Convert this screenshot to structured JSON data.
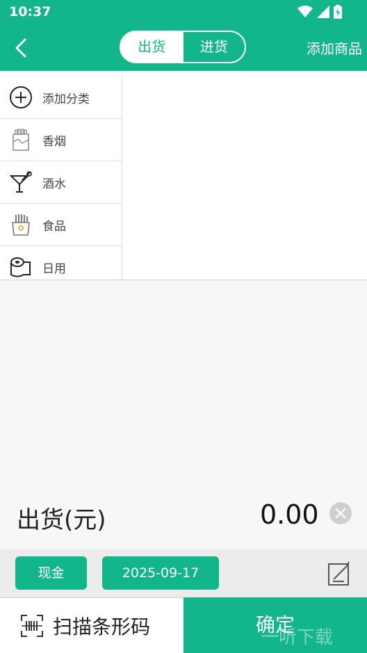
{
  "status": {
    "time": "10:37"
  },
  "header": {
    "tabs": [
      {
        "label": "出货",
        "active": true
      },
      {
        "label": "进货",
        "active": false
      }
    ],
    "add_product": "添加商品"
  },
  "categories": [
    {
      "label": "添加分类",
      "icon": "plus-circle-icon"
    },
    {
      "label": "香烟",
      "icon": "cigarette-pack-icon"
    },
    {
      "label": "酒水",
      "icon": "cocktail-icon"
    },
    {
      "label": "食品",
      "icon": "fries-icon"
    },
    {
      "label": "日用",
      "icon": "toilet-paper-icon"
    }
  ],
  "summary": {
    "label": "出货(元)",
    "amount": "0.00"
  },
  "payment": {
    "method": "现金",
    "date": "2025-09-17"
  },
  "actions": {
    "scan": "扫描条形码",
    "confirm": "确定"
  },
  "watermark": "一听下载",
  "colors": {
    "accent": "#13b58b"
  }
}
